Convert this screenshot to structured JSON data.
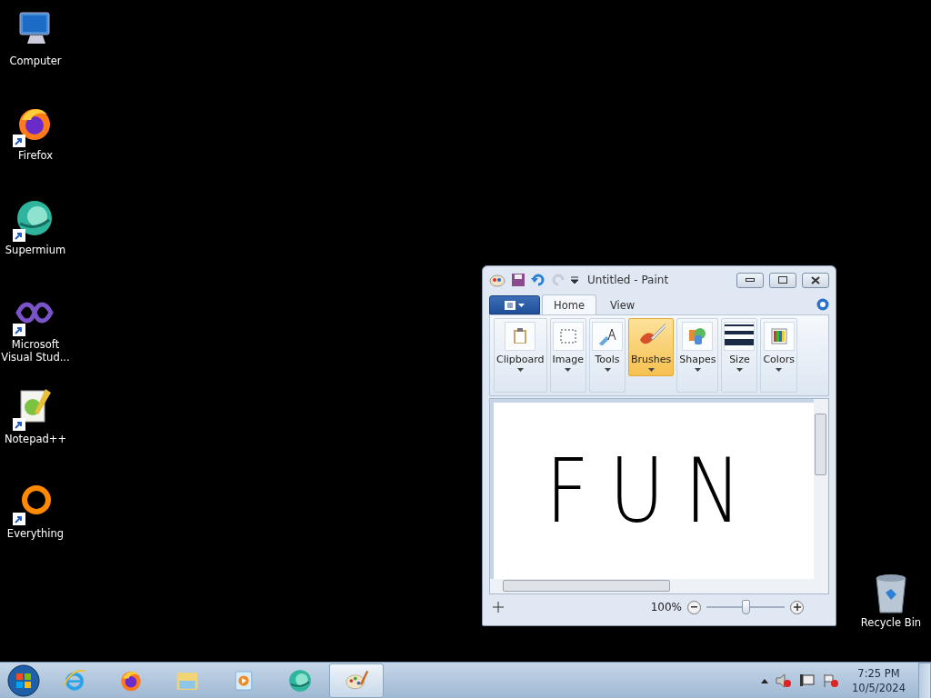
{
  "desktop_icons": [
    {
      "label": "Computer",
      "kind": "computer",
      "shortcut": false
    },
    {
      "label": "Firefox",
      "kind": "firefox",
      "shortcut": true
    },
    {
      "label": "Supermium",
      "kind": "supermium",
      "shortcut": true
    },
    {
      "label": "Microsoft Visual Stud...",
      "kind": "vstudio",
      "shortcut": true
    },
    {
      "label": "Notepad++",
      "kind": "notepad",
      "shortcut": true
    },
    {
      "label": "Everything",
      "kind": "everything",
      "shortcut": true
    }
  ],
  "recycle_bin": {
    "label": "Recycle Bin"
  },
  "paint_window": {
    "title": "Untitled - Paint",
    "tabs": [
      {
        "label": "Home",
        "selected": true
      },
      {
        "label": "View",
        "selected": false
      }
    ],
    "ribbon_groups": [
      {
        "label": "Clipboard",
        "kind": "clipboard",
        "selected": false
      },
      {
        "label": "Image",
        "kind": "image",
        "selected": false
      },
      {
        "label": "Tools",
        "kind": "tools",
        "selected": false
      },
      {
        "label": "Brushes",
        "kind": "brushes",
        "selected": true
      },
      {
        "label": "Shapes",
        "kind": "shapes",
        "selected": false
      },
      {
        "label": "Size",
        "kind": "size",
        "selected": false
      },
      {
        "label": "Colors",
        "kind": "colors",
        "selected": false
      }
    ],
    "canvas_text": "FUN",
    "zoom": {
      "reading": "100%",
      "level": 0.5
    }
  },
  "taskbar": {
    "items": [
      {
        "kind": "ie",
        "selected": false
      },
      {
        "kind": "firefox",
        "selected": false
      },
      {
        "kind": "explorer",
        "selected": false
      },
      {
        "kind": "media",
        "selected": false
      },
      {
        "kind": "supermium",
        "selected": false
      },
      {
        "kind": "paint",
        "selected": true
      }
    ],
    "time": "7:25 PM",
    "date": "10/5/2024"
  }
}
